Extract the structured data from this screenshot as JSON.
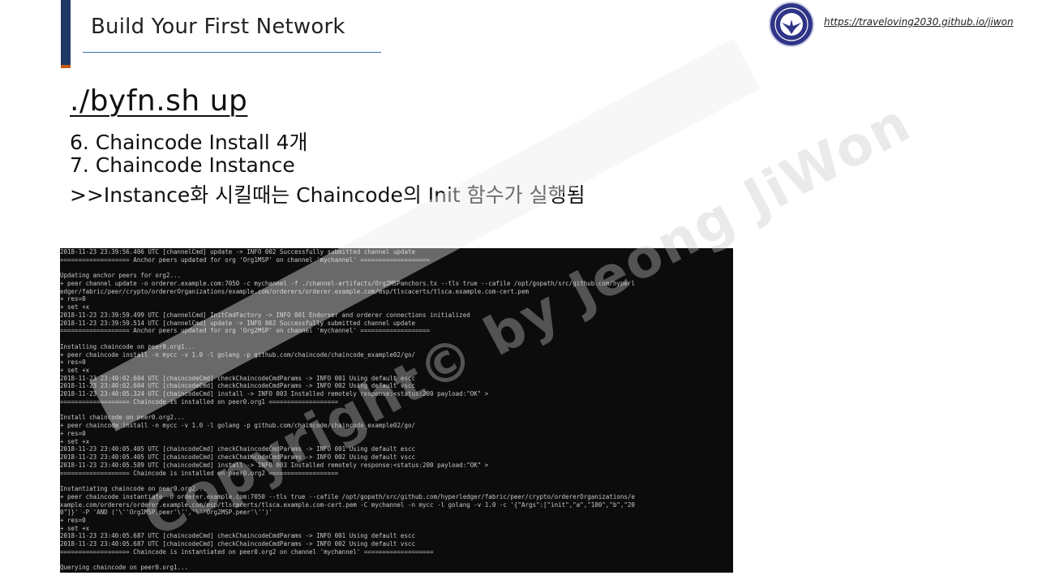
{
  "slide": {
    "title": "Build Your First Network",
    "link": "https://traveloving2030.github.io/jiwon",
    "command": "./byfn.sh up",
    "lines": [
      "6. Chaincode Install 4개",
      "7. Chaincode Instance",
      ">>Instance화 시킬때는 Chaincode의 Init 함수가 실행됨"
    ],
    "watermark": "Copyright© by Jeong JiWon"
  },
  "colors": {
    "accent": "#1f3864",
    "accent_orange": "#c55a11",
    "rule": "#2e75b6",
    "logo": "#2f3487"
  },
  "terminal": {
    "lines": [
      "2018-11-23 23:39:56.406 UTC [channelCmd] update -> INFO 002 Successfully submitted channel update",
      "=================== Anchor peers updated for org 'Org1MSP' on channel 'mychannel' ===================",
      "",
      "Updating anchor peers for org2...",
      "+ peer channel update -o orderer.example.com:7050 -c mychannel -f ./channel-artifacts/Org2MSPanchors.tx --tls true --cafile /opt/gopath/src/github.com/hyperl",
      "edger/fabric/peer/crypto/ordererOrganizations/example.com/orderers/orderer.example.com/msp/tlscacerts/tlsca.example.com-cert.pem",
      "+ res=0",
      "+ set +x",
      "2018-11-23 23:39:59.499 UTC [channelCmd] InitCmdFactory -> INFO 001 Endorser and orderer connections initialized",
      "2018-11-23 23:39:59.514 UTC [channelCmd] update -> INFO 002 Successfully submitted channel update",
      "=================== Anchor peers updated for org 'Org2MSP' on channel 'mychannel' ===================",
      "",
      "Installing chaincode on peer0.org1...",
      "+ peer chaincode install -n mycc -v 1.0 -l golang -p github.com/chaincode/chaincode_example02/go/",
      "+ res=0",
      "+ set +x",
      "2018-11-23 23:40:02.604 UTC [chaincodeCmd] checkChaincodeCmdParams -> INFO 001 Using default escc",
      "2018-11-23 23:40:02.604 UTC [chaincodeCmd] checkChaincodeCmdParams -> INFO 002 Using default vscc",
      "2018-11-23 23:40:05.324 UTC [chaincodeCmd] install -> INFO 003 Installed remotely response:<status:200 payload:\"OK\" >",
      "=================== Chaincode is installed on peer0.org1 ===================",
      "",
      "Install chaincode on peer0.org2...",
      "+ peer chaincode install -n mycc -v 1.0 -l golang -p github.com/chaincode/chaincode_example02/go/",
      "+ res=0",
      "+ set +x",
      "2018-11-23 23:40:05.405 UTC [chaincodeCmd] checkChaincodeCmdParams -> INFO 001 Using default escc",
      "2018-11-23 23:40:05.405 UTC [chaincodeCmd] checkChaincodeCmdParams -> INFO 002 Using default vscc",
      "2018-11-23 23:40:05.589 UTC [chaincodeCmd] install -> INFO 003 Installed remotely response:<status:200 payload:\"OK\" >",
      "=================== Chaincode is installed on peer0.org2 ===================",
      "",
      "Instantiating chaincode on peer0.org2...",
      "+ peer chaincode instantiate -o orderer.example.com:7050 --tls true --cafile /opt/gopath/src/github.com/hyperledger/fabric/peer/crypto/ordererOrganizations/e",
      "xample.com/orderers/orderer.example.com/msp/tlscacerts/tlsca.example.com-cert.pem -C mychannel -n mycc -l golang -v 1.0 -c '{\"Args\":[\"init\",\"a\",\"100\",\"b\",\"20",
      "0\"]}' -P 'AND ('\\''Org1MSP.peer'\\'','\\''Org2MSP.peer'\\'')'",
      "+ res=0",
      "+ set +x",
      "2018-11-23 23:40:05.687 UTC [chaincodeCmd] checkChaincodeCmdParams -> INFO 001 Using default escc",
      "2018-11-23 23:40:05.687 UTC [chaincodeCmd] checkChaincodeCmdParams -> INFO 002 Using default vscc",
      "=================== Chaincode is instantiated on peer0.org2 on channel 'mychannel' ===================",
      "",
      "Querying chaincode on peer0.org1..."
    ]
  }
}
